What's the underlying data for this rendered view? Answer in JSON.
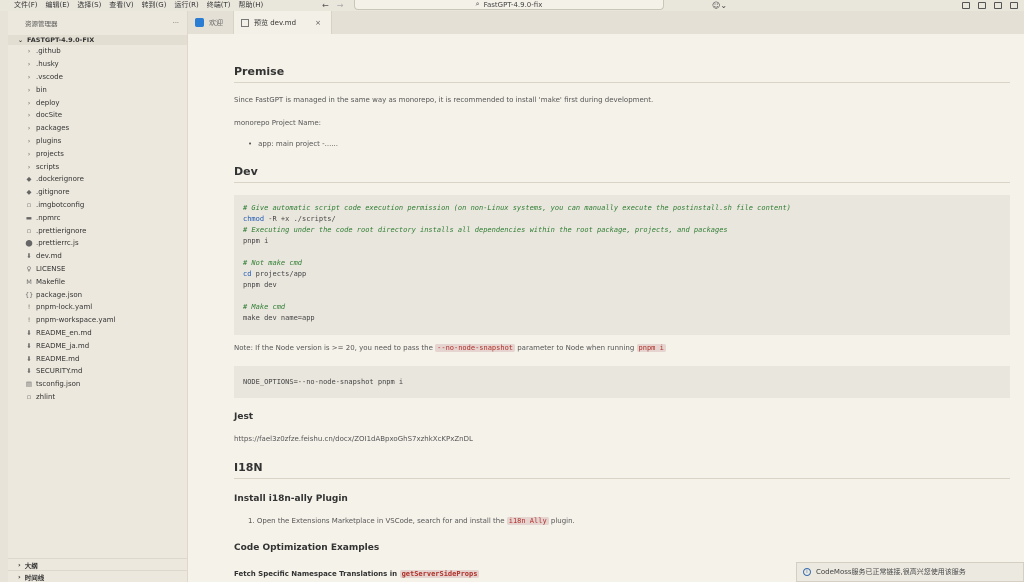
{
  "menu": [
    "文件(F)",
    "编辑(E)",
    "选择(S)",
    "查看(V)",
    "转到(G)",
    "运行(R)",
    "终端(T)",
    "帮助(H)"
  ],
  "command_center": "FastGPT-4.9.0-fix",
  "sidebar": {
    "header": "资源管理器",
    "more": "···",
    "root": "FASTGPT-4.9.0-FIX",
    "items": [
      {
        "label": ".github",
        "icon": "chevron-right-icon",
        "kind": "folder"
      },
      {
        "label": ".husky",
        "icon": "chevron-right-icon",
        "kind": "folder"
      },
      {
        "label": ".vscode",
        "icon": "chevron-right-icon",
        "kind": "folder"
      },
      {
        "label": "bin",
        "icon": "chevron-right-icon",
        "kind": "folder"
      },
      {
        "label": "deploy",
        "icon": "chevron-right-icon",
        "kind": "folder"
      },
      {
        "label": "docSite",
        "icon": "chevron-right-icon",
        "kind": "folder"
      },
      {
        "label": "packages",
        "icon": "chevron-right-icon",
        "kind": "folder"
      },
      {
        "label": "plugins",
        "icon": "chevron-right-icon",
        "kind": "folder"
      },
      {
        "label": "projects",
        "icon": "chevron-right-icon",
        "kind": "folder"
      },
      {
        "label": "scripts",
        "icon": "chevron-right-icon",
        "kind": "folder"
      },
      {
        "label": ".dockerignore",
        "icon": "docker-icon",
        "kind": "git"
      },
      {
        "label": ".gitignore",
        "icon": "git-icon",
        "kind": "git"
      },
      {
        "label": ".imgbotconfig",
        "icon": "file-icon",
        "kind": "file"
      },
      {
        "label": ".npmrc",
        "icon": "npm-icon",
        "kind": "npm"
      },
      {
        "label": ".prettierignore",
        "icon": "prettier-icon",
        "kind": "file"
      },
      {
        "label": ".prettierrc.js",
        "icon": "js-icon",
        "kind": "js"
      },
      {
        "label": "dev.md",
        "icon": "markdown-icon",
        "kind": "md"
      },
      {
        "label": "LICENSE",
        "icon": "license-icon",
        "kind": "lic"
      },
      {
        "label": "Makefile",
        "icon": "makefile-icon",
        "kind": "make"
      },
      {
        "label": "package.json",
        "icon": "json-icon",
        "kind": "json"
      },
      {
        "label": "pnpm-lock.yaml",
        "icon": "yaml-icon",
        "kind": "yaml"
      },
      {
        "label": "pnpm-workspace.yaml",
        "icon": "yaml-icon",
        "kind": "yaml"
      },
      {
        "label": "README_en.md",
        "icon": "markdown-icon",
        "kind": "md"
      },
      {
        "label": "README_ja.md",
        "icon": "markdown-icon",
        "kind": "md"
      },
      {
        "label": "README.md",
        "icon": "markdown-icon",
        "kind": "md"
      },
      {
        "label": "SECURITY.md",
        "icon": "markdown-icon",
        "kind": "md"
      },
      {
        "label": "tsconfig.json",
        "icon": "tsconfig-icon",
        "kind": "ts"
      },
      {
        "label": "zhlint",
        "icon": "file-icon",
        "kind": "file"
      }
    ],
    "outline": "大纲",
    "timeline": "时间线"
  },
  "tabs": [
    {
      "label": "欢迎",
      "active": false
    },
    {
      "label": "预览 dev.md",
      "active": true,
      "close": "×"
    }
  ],
  "doc": {
    "premise_title": "Premise",
    "premise_text": "Since FastGPT is managed in the same way as monorepo, it is recommended to install 'make' first during development.",
    "monorepo_label": "monorepo Project Name:",
    "bullet_app": "app: main project -......",
    "dev_title": "Dev",
    "code1": [
      {
        "type": "comment",
        "text": "# Give automatic script code execution permission (on non-Linux systems, you can manually execute the postinstall.sh file content)"
      },
      {
        "type": "cmd",
        "kw": "chmod",
        "rest": " -R +x ./scripts/"
      },
      {
        "type": "comment",
        "text": "# Executing under the code root directory installs all dependencies within the root package, projects, and packages"
      },
      {
        "type": "plain",
        "text": "pnpm i"
      },
      {
        "type": "plain",
        "text": ""
      },
      {
        "type": "comment",
        "text": "# Not make cmd"
      },
      {
        "type": "cmd",
        "kw": "cd",
        "rest": " projects/app"
      },
      {
        "type": "plain",
        "text": "pnpm dev"
      },
      {
        "type": "plain",
        "text": ""
      },
      {
        "type": "comment",
        "text": "# Make cmd"
      },
      {
        "type": "plain",
        "text": "make dev name=app"
      }
    ],
    "note_prefix": "Note: If the Node version is >= 20, you need to pass the ",
    "note_code1": "--no-node-snapshot",
    "note_mid": " parameter to Node when running ",
    "note_code2": "pnpm i",
    "code2": "NODE_OPTIONS=--no-node-snapshot pnpm i",
    "jest_title": "Jest",
    "jest_link": "https://fael3z0zfze.feishu.cn/docx/ZOI1dABpxoGhS7xzhkXcKPxZnDL",
    "i18n_title": "I18N",
    "i18n_sub": "Install i18n-ally Plugin",
    "i18n_step_num": "1.",
    "i18n_step_prefix": "Open the Extensions Marketplace in VSCode, search for and install the ",
    "i18n_step_code": "i18n Ally",
    "i18n_step_suffix": " plugin.",
    "opt_title": "Code Optimization Examples",
    "fetch_prefix": "Fetch Specific Namespace Translations in ",
    "fetch_code": "getServerSideProps"
  },
  "notification": {
    "icon": "info-icon",
    "text": "CodeMoss服务已正常链接,很高兴您使用该服务"
  }
}
